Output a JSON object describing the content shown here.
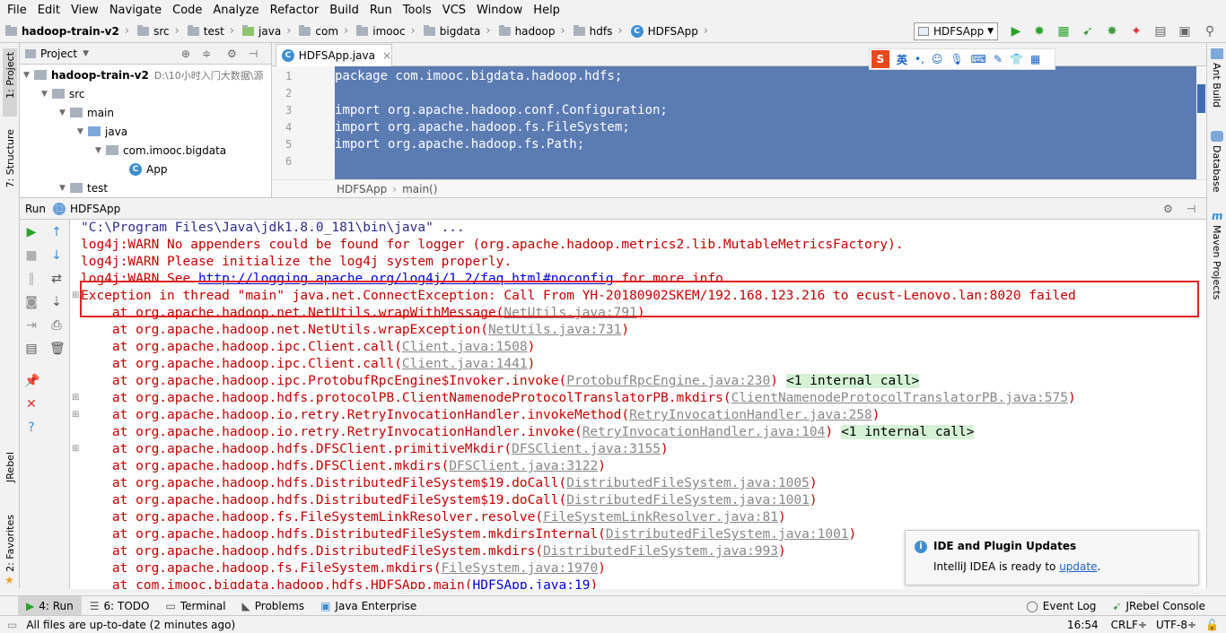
{
  "menu": [
    "File",
    "Edit",
    "View",
    "Navigate",
    "Code",
    "Analyze",
    "Refactor",
    "Build",
    "Run",
    "Tools",
    "VCS",
    "Window",
    "Help"
  ],
  "breadcrumbs": [
    "hadoop-train-v2",
    "src",
    "test",
    "java",
    "com",
    "imooc",
    "bigdata",
    "hadoop",
    "hdfs",
    "HDFSApp"
  ],
  "run_config": "HDFSApp",
  "left_tabs": [
    "1: Project",
    "7: Structure",
    "JRebel",
    "2: Favorites"
  ],
  "right_tabs": [
    "Ant Build",
    "Database",
    "Maven Projects"
  ],
  "project": {
    "header": "Project",
    "root": "hadoop-train-v2",
    "root_path": "D:\\10小时入门大数据\\源",
    "items": [
      "src",
      "main",
      "java",
      "com.imooc.bigdata",
      "App",
      "test"
    ]
  },
  "editor": {
    "tab": "HDFSApp.java",
    "lines": [
      {
        "n": "1",
        "t": "package com.imooc.bigdata.hadoop.hdfs;"
      },
      {
        "n": "2",
        "t": ""
      },
      {
        "n": "3",
        "t": "import org.apache.hadoop.conf.Configuration;"
      },
      {
        "n": "4",
        "t": "import org.apache.hadoop.fs.FileSystem;"
      },
      {
        "n": "5",
        "t": "import org.apache.hadoop.fs.Path;"
      },
      {
        "n": "6",
        "t": ""
      }
    ],
    "crumb_class": "HDFSApp",
    "crumb_method": "main()"
  },
  "ime": {
    "label": "英"
  },
  "run": {
    "title": "Run",
    "config": "HDFSApp",
    "console": {
      "l1": "\"C:\\Program Files\\Java\\jdk1.8.0_181\\bin\\java\" ...",
      "l2": "log4j:WARN No appenders could be found for logger (org.apache.hadoop.metrics2.lib.MutableMetricsFactory).",
      "l3": "log4j:WARN Please initialize the log4j system properly.",
      "l4a": "log4j:WARN See ",
      "l4b": "http://logging.apache.org/log4j/1.2/faq.html#noconfig",
      "l4c": " for more info.",
      "l5": "Exception in thread \"main\" java.net.ConnectException: Call From YH-20180902SKEM/192.168.123.216 to ecust-Lenovo.lan:8020 failed",
      "stack": [
        {
          "m": "    at org.apache.hadoop.net.NetUtils.wrapWithMessage(",
          "f": "NetUtils.java:791",
          "e": ")",
          "x": ""
        },
        {
          "m": "    at org.apache.hadoop.net.NetUtils.wrapException(",
          "f": "NetUtils.java:731",
          "e": ")",
          "x": ""
        },
        {
          "m": "    at org.apache.hadoop.ipc.Client.call(",
          "f": "Client.java:1508",
          "e": ")",
          "x": ""
        },
        {
          "m": "    at org.apache.hadoop.ipc.Client.call(",
          "f": "Client.java:1441",
          "e": ")",
          "x": ""
        },
        {
          "m": "    at org.apache.hadoop.ipc.ProtobufRpcEngine$Invoker.invoke(",
          "f": "ProtobufRpcEngine.java:230",
          "e": ")",
          "x": "<1 internal call>"
        },
        {
          "m": "    at org.apache.hadoop.hdfs.protocolPB.ClientNamenodeProtocolTranslatorPB.mkdirs(",
          "f": "ClientNamenodeProtocolTranslatorPB.java:575",
          "e": ")",
          "x": ""
        },
        {
          "m": "    at org.apache.hadoop.io.retry.RetryInvocationHandler.invokeMethod(",
          "f": "RetryInvocationHandler.java:258",
          "e": ")",
          "x": ""
        },
        {
          "m": "    at org.apache.hadoop.io.retry.RetryInvocationHandler.invoke(",
          "f": "RetryInvocationHandler.java:104",
          "e": ")",
          "x": "<1 internal call>"
        },
        {
          "m": "    at org.apache.hadoop.hdfs.DFSClient.primitiveMkdir(",
          "f": "DFSClient.java:3155",
          "e": ")",
          "x": ""
        },
        {
          "m": "    at org.apache.hadoop.hdfs.DFSClient.mkdirs(",
          "f": "DFSClient.java:3122",
          "e": ")",
          "x": ""
        },
        {
          "m": "    at org.apache.hadoop.hdfs.DistributedFileSystem$19.doCall(",
          "f": "DistributedFileSystem.java:1005",
          "e": ")",
          "x": ""
        },
        {
          "m": "    at org.apache.hadoop.hdfs.DistributedFileSystem$19.doCall(",
          "f": "DistributedFileSystem.java:1001",
          "e": ")",
          "x": ""
        },
        {
          "m": "    at org.apache.hadoop.fs.FileSystemLinkResolver.resolve(",
          "f": "FileSystemLinkResolver.java:81",
          "e": ")",
          "x": ""
        },
        {
          "m": "    at org.apache.hadoop.hdfs.DistributedFileSystem.mkdirsInternal(",
          "f": "DistributedFileSystem.java:1001",
          "e": ")",
          "x": ""
        },
        {
          "m": "    at org.apache.hadoop.hdfs.DistributedFileSystem.mkdirs(",
          "f": "DistributedFileSystem.java:993",
          "e": ")",
          "x": ""
        },
        {
          "m": "    at org.apache.hadoop.fs.FileSystem.mkdirs(",
          "f": "FileSystem.java:1970",
          "e": ")",
          "x": ""
        }
      ],
      "last_m": "    at com.imooc.bigdata.hadoop.hdfs.HDFSApp.main(",
      "last_f": "HDFSApp.java:19",
      "last_e": ")"
    }
  },
  "bottom_tabs": [
    "4: Run",
    "6: TODO",
    "Terminal",
    "Problems",
    "Java Enterprise"
  ],
  "bottom_right": [
    "Event Log",
    "JRebel Console"
  ],
  "status": {
    "message": "All files are up-to-date (2 minutes ago)",
    "time": "16:54",
    "crlf": "CRLF÷",
    "encoding": "UTF-8÷"
  },
  "notification": {
    "title": "IDE and Plugin Updates",
    "text": "IntelliJ IDEA is ready to ",
    "link": "update",
    "end": "."
  },
  "colors": {
    "accent": "#3d8fd1",
    "error": "#c40000",
    "selection": "#5b7bb3",
    "highlight_box": "#e02020"
  }
}
